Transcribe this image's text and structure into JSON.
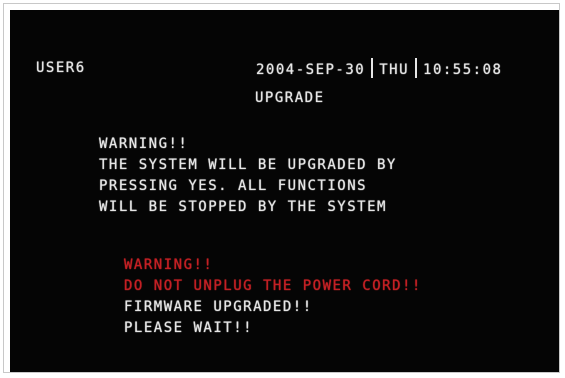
{
  "header": {
    "user": "USER6",
    "date": "2004-SEP-30",
    "weekday": "THU",
    "time": "10:55:08",
    "title": "UPGRADE"
  },
  "warning_block": {
    "lines": [
      "WARNING!!",
      "THE SYSTEM WILL BE UPGRADED BY",
      "PRESSING YES. ALL FUNCTIONS",
      "WILL BE STOPPED BY THE SYSTEM"
    ]
  },
  "status_block": {
    "alert_lines": [
      "WARNING!!",
      "DO NOT UNPLUG THE POWER CORD!!"
    ],
    "info_lines": [
      "FIRMWARE UPGRADED!!",
      "PLEASE WAIT!!"
    ]
  },
  "colors": {
    "screen_bg": "#050505",
    "text": "#e6e6e6",
    "alert": "#c41f24"
  }
}
